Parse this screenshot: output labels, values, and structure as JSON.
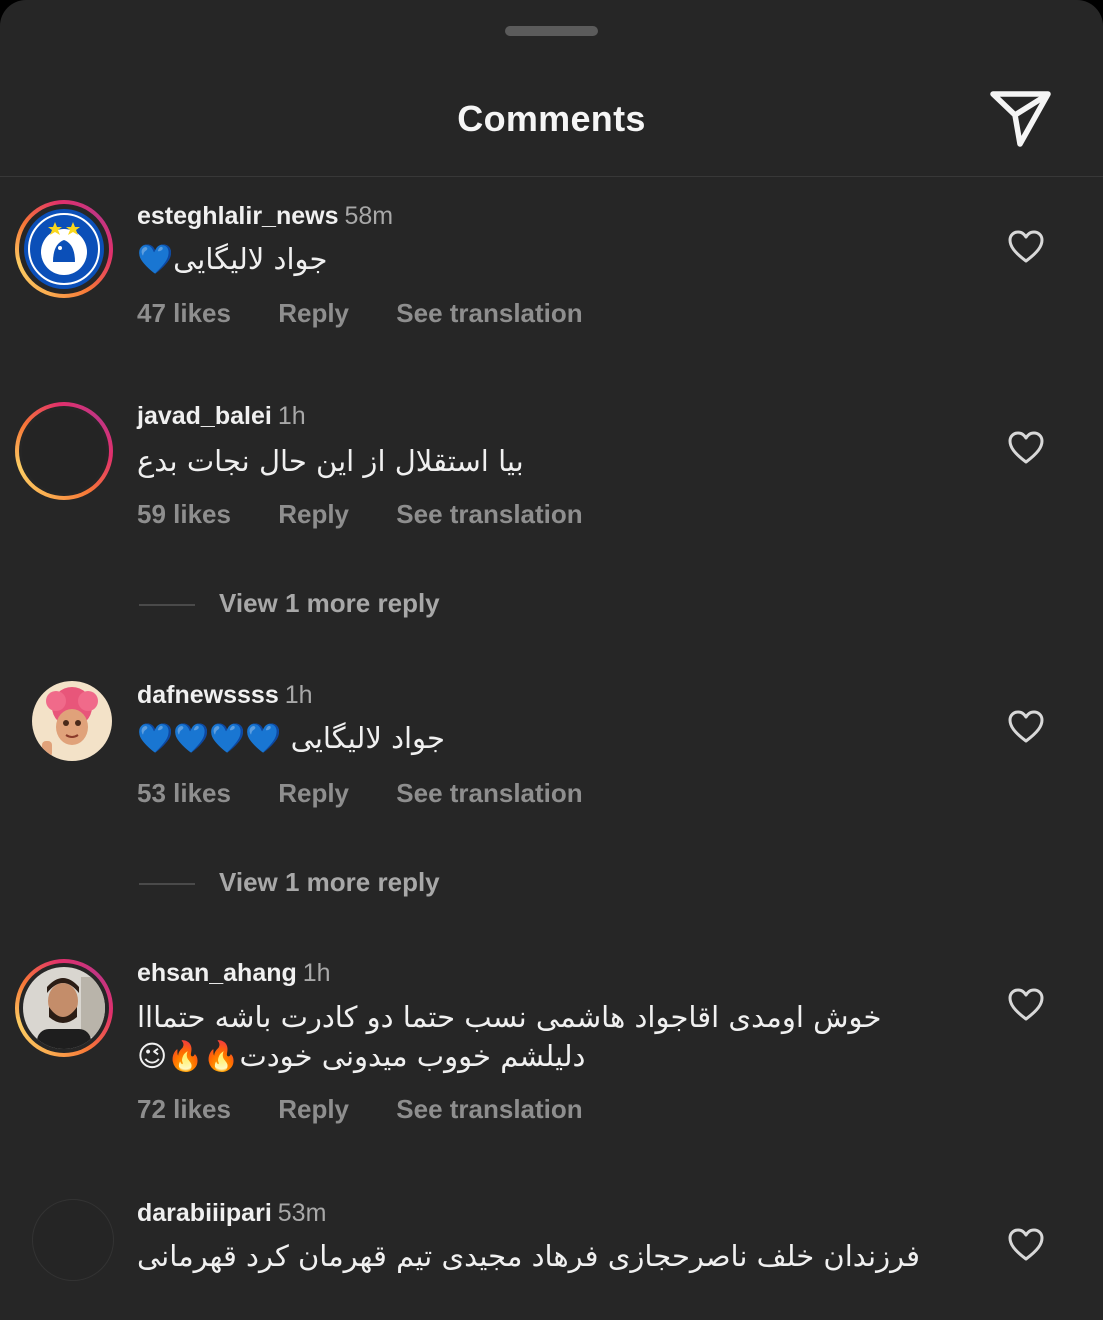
{
  "header": {
    "title": "Comments"
  },
  "comments": [
    {
      "username": "esteghlalir_news",
      "time": "58m",
      "text": "جواد لالیگایی💙",
      "likes": "47 likes",
      "reply": "Reply",
      "translate": "See translation"
    },
    {
      "username": "javad_balei",
      "time": "1h",
      "text": "بیا استقلال از این حال نجات بدع",
      "likes": "59 likes",
      "reply": "Reply",
      "translate": "See translation",
      "view_more": "View 1 more reply"
    },
    {
      "username": "dafnewssss",
      "time": "1h",
      "text": "جواد لالیگایی 💙💙💙💙",
      "likes": "53 likes",
      "reply": "Reply",
      "translate": "See translation",
      "view_more": "View 1 more reply"
    },
    {
      "username": "ehsan_ahang",
      "time": "1h",
      "text_line1": "خوش اومدی اقاجواد هاشمی نسب حتما دو کادرت باشه حتمااا",
      "text_line2": "دلیلشم خووب میدونی خودت🔥🔥😉",
      "likes": "72 likes",
      "reply": "Reply",
      "translate": "See translation"
    },
    {
      "username": "darabiiipari",
      "time": "53m",
      "text": "فرزندان خلف ناصرحجازی فرهاد مجیدی تیم قهرمان کرد قهرمانی"
    }
  ],
  "colors": {
    "background": "#262626",
    "text_primary": "#f0f0f0",
    "text_secondary": "#8e8e8e",
    "blue_heart": "#1e90ff"
  },
  "icons": [
    "share-send-icon",
    "heart-outline-icon",
    "blue-heart-emoji",
    "fire-emoji",
    "wink-emoji"
  ]
}
